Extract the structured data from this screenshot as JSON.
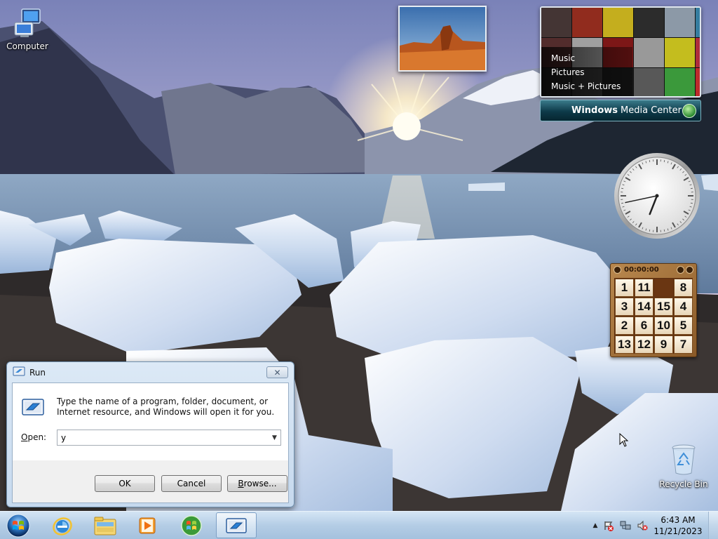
{
  "desktop": {
    "icons": [
      {
        "label": "Computer",
        "icon": "computer-icon"
      },
      {
        "label": "Recycle Bin",
        "icon": "recycle-bin-icon"
      }
    ]
  },
  "gadgets": {
    "slideshow": {
      "icon": "slideshow-photo"
    },
    "media_center": {
      "menu": [
        "Music",
        "Pictures",
        "Music + Pictures"
      ],
      "brand_bold": "Windows",
      "brand_rest": "Media Center"
    },
    "clock": {
      "hour": 6,
      "minute": 43
    },
    "puzzle": {
      "timer": "00:00:00",
      "tiles": [
        [
          "1",
          "11",
          "",
          "8"
        ],
        [
          "3",
          "14",
          "15",
          "4"
        ],
        [
          "2",
          "6",
          "10",
          "5"
        ],
        [
          "13",
          "12",
          "9",
          "7"
        ]
      ]
    }
  },
  "run_dialog": {
    "title": "Run",
    "description": "Type the name of a program, folder, document, or Internet resource, and Windows will open it for you.",
    "open_label_accel": "O",
    "open_label_rest": "pen:",
    "open_value": "y",
    "ok_label": "OK",
    "cancel_label": "Cancel",
    "browse_accel": "B",
    "browse_rest": "rowse..."
  },
  "taskbar": {
    "pinned": [
      "internet-explorer-icon",
      "file-explorer-icon",
      "media-player-icon",
      "media-center-icon",
      "run-icon"
    ],
    "time": "6:43 AM",
    "date": "11/21/2023"
  },
  "colors": {
    "accent": "#3a7b8a",
    "taskbar": "#b0cae4",
    "dialog_border": "#6f8fae"
  }
}
